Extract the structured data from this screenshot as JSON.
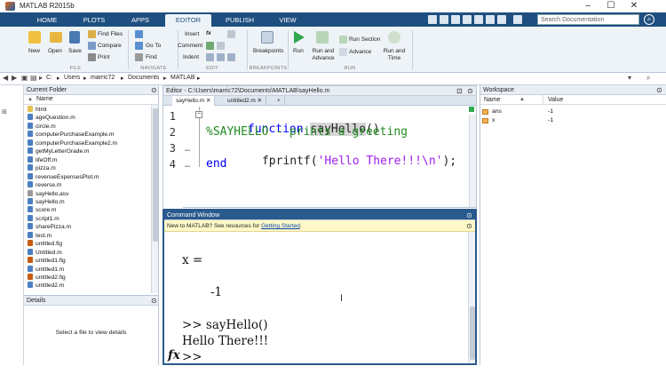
{
  "window": {
    "title": "MATLAB R2015b"
  },
  "tabs": [
    "HOME",
    "PLOTS",
    "APPS",
    "EDITOR",
    "PUBLISH",
    "VIEW"
  ],
  "active_tab": "EDITOR",
  "search": {
    "placeholder": "Search Documentation"
  },
  "toolstrip": {
    "file": {
      "label": "FILE",
      "new": "New",
      "open": "Open",
      "save": "Save",
      "find_files": "Find Files",
      "compare": "Compare",
      "print": "Print"
    },
    "navigate": {
      "label": "NAVIGATE",
      "go_to": "Go To",
      "find": "Find"
    },
    "edit": {
      "label": "EDIT",
      "insert": "Insert",
      "comment": "Comment",
      "indent": "Indent",
      "fx": "fx"
    },
    "breakpoints": {
      "label": "BREAKPOINTS",
      "breakpoints": "Breakpoints"
    },
    "run": {
      "label": "RUN",
      "run": "Run",
      "run_and_advance": "Run and Advance",
      "run_section": "Run Section",
      "advance": "Advance",
      "run_and_time": "Run and Time"
    }
  },
  "address": {
    "parts": [
      "C:",
      "Users",
      "marric72",
      "Documents",
      "MATLAB"
    ]
  },
  "current_folder": {
    "title": "Current Folder",
    "column": "Name",
    "files": [
      {
        "name": "html",
        "type": "folder"
      },
      {
        "name": "ageQuestion.m",
        "type": "m"
      },
      {
        "name": "circle.m",
        "type": "m"
      },
      {
        "name": "computerPurchaseExample.m",
        "type": "m"
      },
      {
        "name": "computerPurchaseExample2.m",
        "type": "m"
      },
      {
        "name": "getMyLetterGrade.m",
        "type": "m"
      },
      {
        "name": "lifeOff.m",
        "type": "m"
      },
      {
        "name": "pizza.m",
        "type": "m"
      },
      {
        "name": "revenueExpensesPlot.m",
        "type": "m"
      },
      {
        "name": "reverse.m",
        "type": "m"
      },
      {
        "name": "sayHello.asv",
        "type": "asv"
      },
      {
        "name": "sayHello.m",
        "type": "m"
      },
      {
        "name": "score.m",
        "type": "m"
      },
      {
        "name": "script1.m",
        "type": "m"
      },
      {
        "name": "sharePizza.m",
        "type": "m"
      },
      {
        "name": "test.m",
        "type": "m"
      },
      {
        "name": "untitled.fig",
        "type": "fig"
      },
      {
        "name": "Untitled.m",
        "type": "m"
      },
      {
        "name": "untitled1.fig",
        "type": "fig"
      },
      {
        "name": "untitled1.m",
        "type": "m"
      },
      {
        "name": "untitled2.fig",
        "type": "fig"
      },
      {
        "name": "untitled2.m",
        "type": "m"
      }
    ]
  },
  "details": {
    "title": "Details",
    "message": "Select a file to view details"
  },
  "editor": {
    "title": "Editor - C:\\Users\\marric72\\Documents\\MATLAB\\sayHello.m",
    "tabs": [
      "sayHello.m",
      "untitled2.m",
      "+"
    ],
    "line_numbers": [
      "1",
      "2",
      "3",
      "4"
    ],
    "lines": {
      "l1_kw": "function",
      "l1_name": "sayHello",
      "l1_rest": "()",
      "l2": "%SAYHELLO - prints a greeting",
      "l3_pre": "fprintf(",
      "l3_str": "'Hello There!!!\\n'",
      "l3_post": ");",
      "l4": "end"
    }
  },
  "command_window": {
    "title": "Command Window",
    "tip_text": "New to MATLAB? See resources for ",
    "tip_link": "Getting Started",
    "tip_end": ".",
    "lines": [
      "x =",
      "-1",
      ">> sayHello()",
      "Hello There!!!",
      ">>"
    ],
    "fx": "fx"
  },
  "workspace": {
    "title": "Workspace",
    "columns": [
      "Name",
      "Value"
    ],
    "vars": [
      {
        "name": "ans",
        "value": "-1"
      },
      {
        "name": "x",
        "value": "-1"
      }
    ]
  }
}
